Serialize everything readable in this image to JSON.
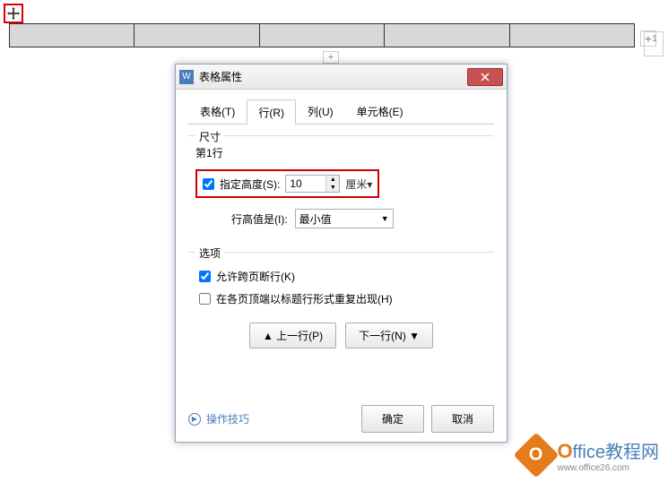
{
  "dialog": {
    "title": "表格属性",
    "tabs": [
      "表格(T)",
      "行(R)",
      "列(U)",
      "单元格(E)"
    ],
    "size_group": "尺寸",
    "row_num": "第1行",
    "specify_height_label": "指定高度(S):",
    "height_value": "10",
    "unit": "厘米▾",
    "row_height_is_label": "行高值是(I):",
    "row_height_mode": "最小值",
    "options_group": "选项",
    "allow_break": "允许跨页断行(K)",
    "repeat_header": "在各页顶端以标题行形式重复出现(H)",
    "prev_btn": "▲ 上一行(P)",
    "next_btn": "下一行(N) ▼",
    "tips": "操作技巧",
    "ok": "确定",
    "cancel": "取消"
  },
  "watermark": {
    "brand_first": "O",
    "brand_rest": "ffice教程网",
    "url": "www.office26.com"
  }
}
